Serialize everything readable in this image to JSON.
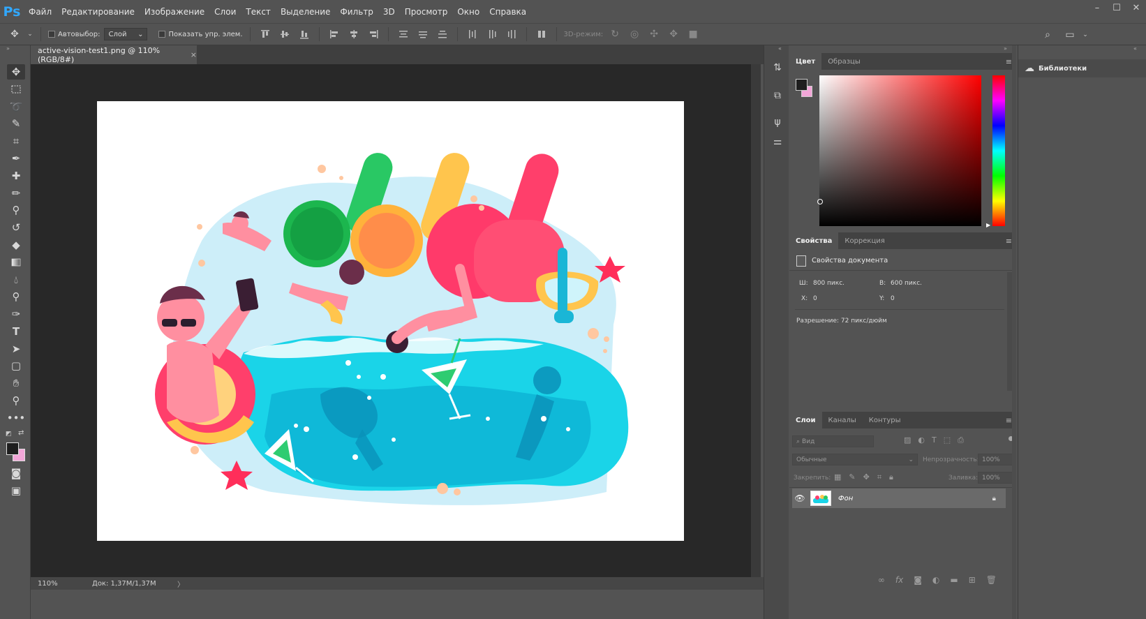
{
  "app": {
    "logo": "Ps"
  },
  "menu": [
    "Файл",
    "Редактирование",
    "Изображение",
    "Слои",
    "Текст",
    "Выделение",
    "Фильтр",
    "3D",
    "Просмотр",
    "Окно",
    "Справка"
  ],
  "window_controls": {
    "minimize": "–",
    "maximize": "☐",
    "close": "✕"
  },
  "options_bar": {
    "autoselect_label": "Автовыбор:",
    "autoselect_target": "Слой",
    "show_transform_label": "Показать упр. элем.",
    "mode_3d_label": "3D-режим:"
  },
  "document": {
    "tab_title": "active-vision-test1.png @ 110% (RGB/8#)",
    "tab_close": "×",
    "zoom": "110%",
    "doc_size": "Док: 1,37M/1,37M",
    "status_arrow": "〉"
  },
  "color_panel": {
    "tabs": [
      "Цвет",
      "Образцы"
    ],
    "foreground": "#1e1e1e",
    "background": "#f2a6d8"
  },
  "properties_panel": {
    "tabs": [
      "Свойства",
      "Коррекция"
    ],
    "section_title": "Свойства документа",
    "width_label": "Ш:",
    "width_value": "800 пикс.",
    "height_label": "В:",
    "height_value": "600 пикс.",
    "x_label": "X:",
    "x_value": "0",
    "y_label": "Y:",
    "y_value": "0",
    "resolution": "Разрешение: 72 пикс/дюйм"
  },
  "layers_panel": {
    "tabs": [
      "Слои",
      "Каналы",
      "Контуры"
    ],
    "search_placeholder": "Вид",
    "blend_mode": "Обычные",
    "opacity_label": "Непрозрачность:",
    "opacity_value": "100%",
    "lock_label": "Закрепить:",
    "fill_label": "Заливка:",
    "fill_value": "100%",
    "layers": [
      {
        "name": "Фон"
      }
    ]
  },
  "libraries": {
    "label": "Библиотеки"
  },
  "colors": {
    "accent": "#31a8ff",
    "panel_bg": "#535353",
    "canvas_bg": "#282828"
  }
}
